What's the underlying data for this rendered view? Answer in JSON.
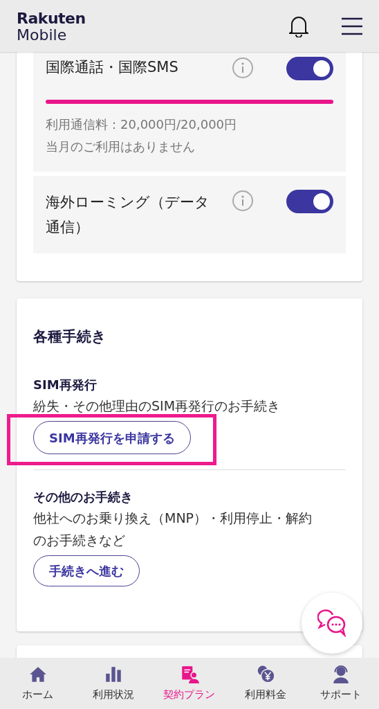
{
  "header": {
    "logo_line_1": "Rakuten",
    "logo_line_2": "Mobile"
  },
  "settings": [
    {
      "label": "国際通話・国際SMS",
      "on": true,
      "level": 1,
      "usage": "利用通信料：20,000円/20,000円",
      "note": "当月のご利用はありません"
    },
    {
      "label": "海外ローミング（データ通信）",
      "on": true
    }
  ],
  "procedures": {
    "title": "各種手続き",
    "items": [
      {
        "title": "SIM再発行",
        "description": "紛失・その他理由のSIM再発行のお手続き",
        "button": "SIM再発行を申請する",
        "highlighted": true
      },
      {
        "title": "その他のお手続き",
        "description": "他社へのお乗り換え（MNP）・利用停止・解約のお手続きなど",
        "button": "手続きへ進む",
        "highlighted": false
      }
    ]
  },
  "bottom_nav": [
    {
      "label": "ホーム",
      "kind": "home",
      "selected": false
    },
    {
      "label": "利用状況",
      "kind": "usage",
      "selected": false
    },
    {
      "label": "契約プラン",
      "kind": "plan",
      "selected": true
    },
    {
      "label": "利用料金",
      "kind": "fee",
      "selected": false
    },
    {
      "label": "サポート",
      "kind": "support",
      "selected": false
    }
  ]
}
